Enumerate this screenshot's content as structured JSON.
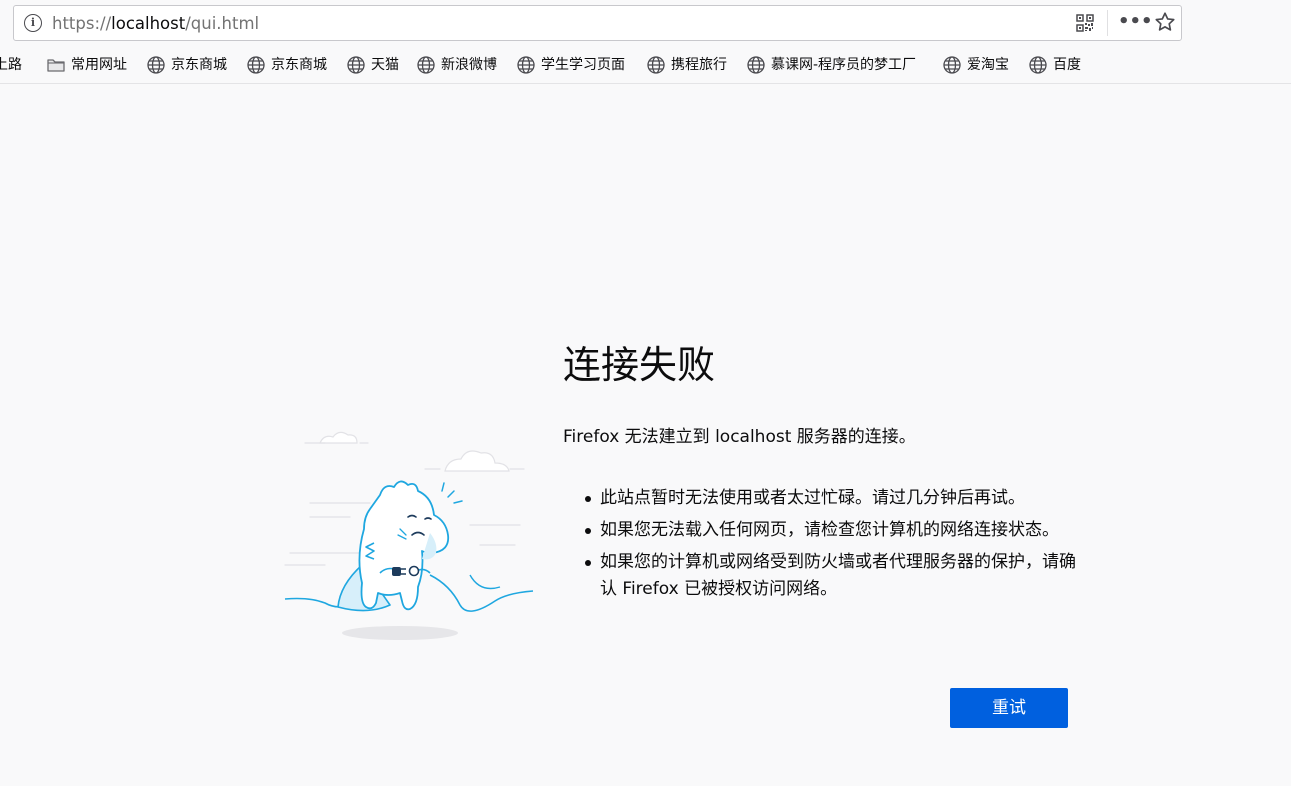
{
  "address_bar": {
    "url_prefix": "https://",
    "url_host": "localhost",
    "url_path": "/qui.html"
  },
  "bookmarks": {
    "partial_label": "上路",
    "items": [
      {
        "label": "常用网址",
        "icon": "folder-icon"
      },
      {
        "label": "京东商城",
        "icon": "globe-icon"
      },
      {
        "label": "京东商城",
        "icon": "globe-icon"
      },
      {
        "label": "天猫",
        "icon": "globe-icon"
      },
      {
        "label": "新浪微博",
        "icon": "globe-icon"
      },
      {
        "label": "学生学习页面",
        "icon": "globe-icon"
      },
      {
        "label": "携程旅行",
        "icon": "globe-icon"
      },
      {
        "label": "慕课网-程序员的梦工厂",
        "icon": "globe-icon"
      },
      {
        "label": "爱淘宝",
        "icon": "globe-icon"
      },
      {
        "label": "百度",
        "icon": "globe-icon"
      }
    ]
  },
  "error_page": {
    "title": "连接失败",
    "description": "Firefox 无法建立到 localhost 服务器的连接。",
    "reasons": [
      "此站点暂时无法使用或者太过忙碌。请过几分钟后再试。",
      "如果您无法载入任何网页，请检查您计算机的网络连接状态。",
      "如果您的计算机或网络受到防火墙或者代理服务器的保护，请确认 Firefox 已被授权访问网络。"
    ],
    "retry_label": "重试"
  },
  "colors": {
    "page_background": "#f9f9fa",
    "primary_button": "#0060df",
    "illustration_stroke": "#1fa7e0"
  }
}
